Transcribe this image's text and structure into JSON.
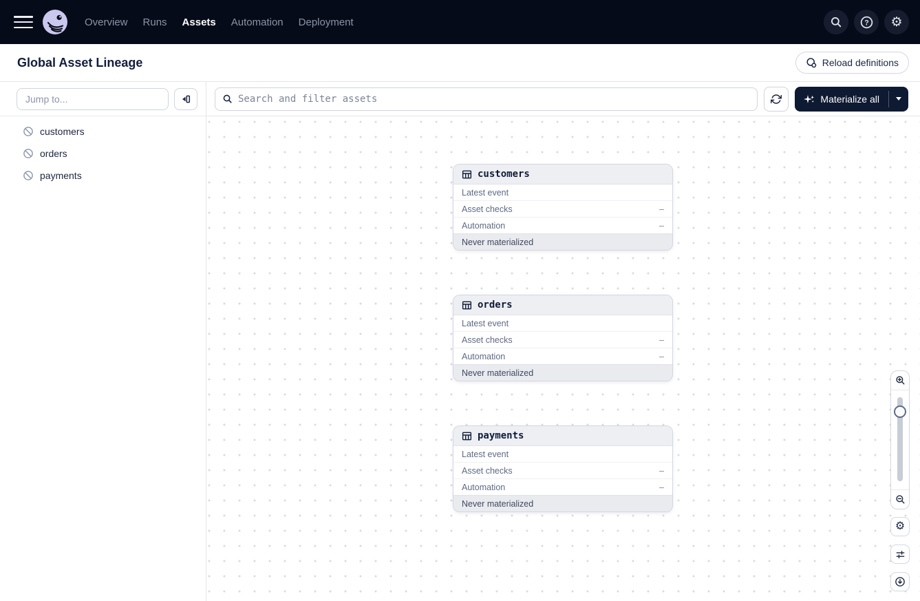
{
  "nav": {
    "items": [
      "Overview",
      "Runs",
      "Assets",
      "Automation",
      "Deployment"
    ],
    "active_item": "Assets",
    "action_icons": [
      "search-icon",
      "help-icon",
      "gear-icon"
    ]
  },
  "page_header": {
    "title": "Global Asset Lineage",
    "reload_button_label": "Reload definitions"
  },
  "sidebar": {
    "jump_to_placeholder": "Jump to...",
    "assets": [
      "customers",
      "orders",
      "payments"
    ]
  },
  "toolbar": {
    "search_placeholder": "Search and filter assets",
    "materialize_button_label": "Materialize all"
  },
  "graph": {
    "nodes": [
      {
        "name": "customers",
        "rows": [
          {
            "label": "Latest event",
            "value": ""
          },
          {
            "label": "Asset checks",
            "value": "–"
          },
          {
            "label": "Automation",
            "value": "–"
          }
        ],
        "status": "Never materialized"
      },
      {
        "name": "orders",
        "rows": [
          {
            "label": "Latest event",
            "value": ""
          },
          {
            "label": "Asset checks",
            "value": "–"
          },
          {
            "label": "Automation",
            "value": "–"
          }
        ],
        "status": "Never materialized"
      },
      {
        "name": "payments",
        "rows": [
          {
            "label": "Latest event",
            "value": ""
          },
          {
            "label": "Asset checks",
            "value": "–"
          },
          {
            "label": "Automation",
            "value": "–"
          }
        ],
        "status": "Never materialized"
      }
    ]
  },
  "colors": {
    "nav_bg": "#050b18",
    "accent_button_bg": "#0e1a32",
    "logo_lavender": "#cbc8ef",
    "node_header_bg": "#edeff3",
    "canvas_dot": "#d9dce2"
  }
}
